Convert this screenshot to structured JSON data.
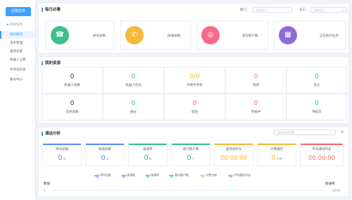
{
  "sidebar": {
    "create_label": "创建任务",
    "items": [
      {
        "label": "外呼任务"
      },
      {
        "label": "每日概况"
      },
      {
        "label": "话术管理"
      },
      {
        "label": "通话记录"
      },
      {
        "label": "机器人之家"
      },
      {
        "label": "外呼号码池"
      },
      {
        "label": "账号中心"
      }
    ]
  },
  "daily": {
    "title": "每日必看",
    "dept_label": "部门：",
    "dept_placeholder": "选择部门",
    "staff_label": "员工：",
    "staff_placeholder": "选择员工",
    "cards": [
      {
        "label": "呼叫总数",
        "icon": "phone-refresh-icon",
        "color": "#3dbf8a"
      },
      {
        "label": "接通总数",
        "icon": "phone-icon",
        "color": "#f7b738"
      },
      {
        "label": "意向客户数",
        "icon": "target-icon",
        "color": "#f56c8a"
      },
      {
        "label": "正在执行任务",
        "icon": "calendar-icon",
        "color": "#8f6bd8"
      }
    ]
  },
  "resources": {
    "title": "我的资源",
    "cells": [
      {
        "value": "0",
        "label": "机器人总数",
        "color": "#303133"
      },
      {
        "value": "0",
        "label": "机器人空闲",
        "color": "#3dbf8a"
      },
      {
        "value": "0/0",
        "label": "外呼中手机",
        "color": "#f7b738"
      },
      {
        "value": "0",
        "label": "暂停",
        "color": "#f56c6c"
      },
      {
        "value": "0",
        "label": "停止",
        "color": "#3dbf8a"
      },
      {
        "value": "0",
        "label": "话术总数",
        "color": "#303133"
      },
      {
        "value": "0",
        "label": "通过",
        "color": "#3dbf8a"
      },
      {
        "value": "0",
        "label": "驳回",
        "color": "#f56c6c"
      },
      {
        "value": "0",
        "label": "审核中",
        "color": "#f56c6c"
      },
      {
        "value": "0",
        "label": "待提交",
        "color": "#3dbf8a"
      }
    ]
  },
  "analysis": {
    "title": "通话分析",
    "time_placeholder": "选择时间范围",
    "boxes": [
      {
        "label": "呼叫总数",
        "value": "0",
        "unit": "次",
        "color": "#5b8ff9"
      },
      {
        "label": "接通总数",
        "value": "0",
        "unit": "次",
        "color": "#5b8ff9"
      },
      {
        "label": "接通率",
        "value": "0",
        "unit": "%",
        "color": "#3dbf8a"
      },
      {
        "label": "意向客户数",
        "value": "0",
        "unit": "个",
        "color": "#3dbf8a"
      },
      {
        "label": "通话总时长",
        "value": "00:00:00",
        "unit": "",
        "color": "#f7b738"
      },
      {
        "label": "计费通时",
        "value": "0",
        "unit": "分钟",
        "color": "#f7b738"
      },
      {
        "label": "平均通话时长",
        "value": "00:00:00",
        "unit": "",
        "color": "#f56c6c"
      }
    ],
    "legend": [
      {
        "label": "呼叫总数",
        "color": "#5b8ff9"
      },
      {
        "label": "接通数",
        "color": "#5b8ff9"
      },
      {
        "label": "接通率",
        "color": "#3dbf8a"
      },
      {
        "label": "意向客户数",
        "color": "#3dbf8a"
      },
      {
        "label": "计费分钟",
        "color": "#f7b738"
      },
      {
        "label": "平均通话时长",
        "color": "#f56c6c"
      }
    ],
    "y_label": "数值",
    "y_tick": "1",
    "rate_label": "接通率",
    "rate_tick": "100%"
  }
}
